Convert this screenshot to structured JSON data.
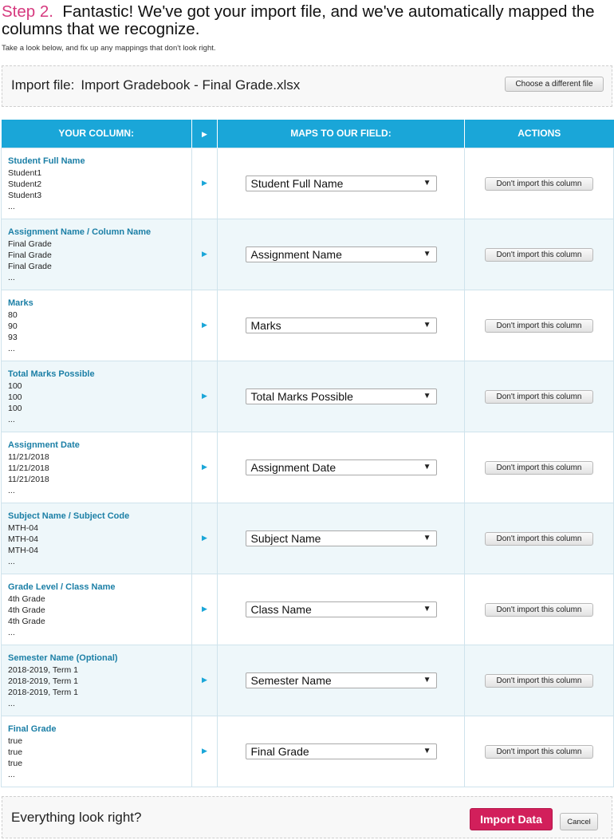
{
  "heading": {
    "step": "Step 2.",
    "title": "Fantastic! We've got your import file, and we've automatically mapped the columns that we recognize.",
    "subtitle": "Take a look below, and fix up any mappings that don't look right."
  },
  "file": {
    "label": "Import file:",
    "filename": "Import Gradebook - Final Grade.xlsx",
    "change_button": "Choose a different file"
  },
  "table": {
    "headers": {
      "your_column": "YOUR COLUMN:",
      "arrow": "▶",
      "maps_to": "MAPS TO OUR FIELD:",
      "actions": "ACTIONS"
    },
    "row_arrow": "▶",
    "select_caret": "▼",
    "action_label": "Don't import this column",
    "rows": [
      {
        "column": "Student Full Name",
        "samples": [
          "Student1",
          "Student2",
          "Student3",
          "..."
        ],
        "field": "Student Full Name"
      },
      {
        "column": "Assignment Name / Column Name",
        "samples": [
          "Final Grade",
          "Final Grade",
          "Final Grade",
          "..."
        ],
        "field": "Assignment Name"
      },
      {
        "column": "Marks",
        "samples": [
          "80",
          "90",
          "93",
          "..."
        ],
        "field": "Marks"
      },
      {
        "column": "Total Marks Possible",
        "samples": [
          "100",
          "100",
          "100",
          "..."
        ],
        "field": "Total Marks Possible"
      },
      {
        "column": "Assignment Date",
        "samples": [
          "11/21/2018",
          "11/21/2018",
          "11/21/2018",
          "..."
        ],
        "field": "Assignment Date"
      },
      {
        "column": "Subject Name / Subject Code",
        "samples": [
          "MTH-04",
          "MTH-04",
          "MTH-04",
          "..."
        ],
        "field": "Subject Name"
      },
      {
        "column": "Grade Level / Class Name",
        "samples": [
          "4th Grade",
          "4th Grade",
          "4th Grade",
          "..."
        ],
        "field": "Class Name"
      },
      {
        "column": "Semester Name (Optional)",
        "samples": [
          "2018-2019, Term 1",
          "2018-2019, Term 1",
          "2018-2019, Term 1",
          "..."
        ],
        "field": "Semester Name"
      },
      {
        "column": "Final Grade",
        "samples": [
          "true",
          "true",
          "true",
          "..."
        ],
        "field": "Final Grade"
      }
    ]
  },
  "footer": {
    "question": "Everything look right?",
    "import_button": "Import Data",
    "cancel_button": "Cancel"
  }
}
